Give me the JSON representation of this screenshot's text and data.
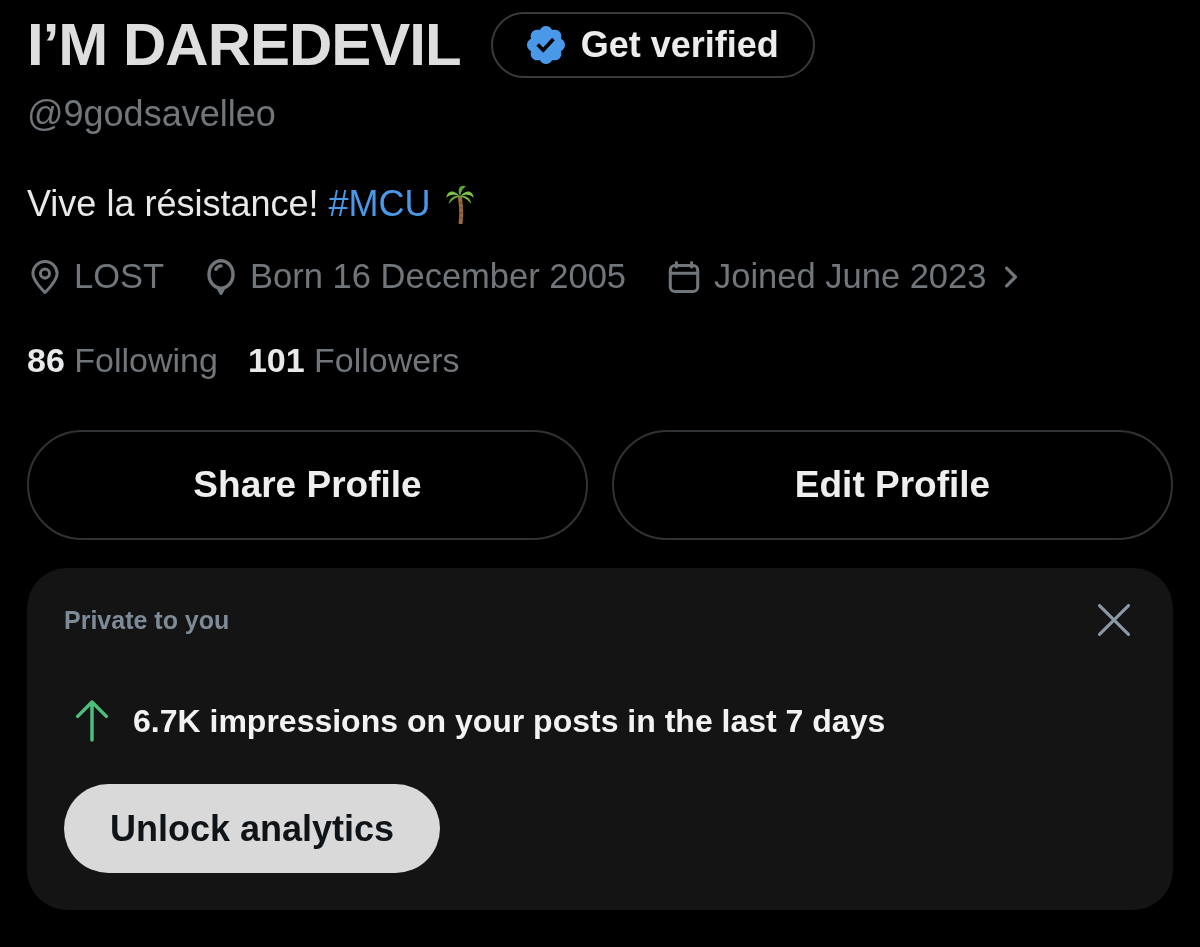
{
  "profile": {
    "display_name": "I’M DAREDEVIL",
    "verify_button": "Get verified",
    "handle": "@9godsavelleo",
    "bio": {
      "text": "Vive la résistance!",
      "hashtag": "#MCU"
    },
    "details": [
      {
        "kind": "location",
        "text": "LOST"
      },
      {
        "kind": "birthday",
        "text": "Born 16 December 2005"
      },
      {
        "kind": "joined",
        "text": "Joined June 2023"
      }
    ],
    "stats": [
      {
        "count": "86",
        "label": "Following"
      },
      {
        "count": "101",
        "label": "Followers"
      }
    ],
    "buttons": [
      "Share Profile",
      "Edit Profile"
    ]
  },
  "analytics_card": {
    "title": "Private to you",
    "summary": "6.7K impressions on your posts in the last 7 days",
    "button": "Unlock analytics"
  }
}
